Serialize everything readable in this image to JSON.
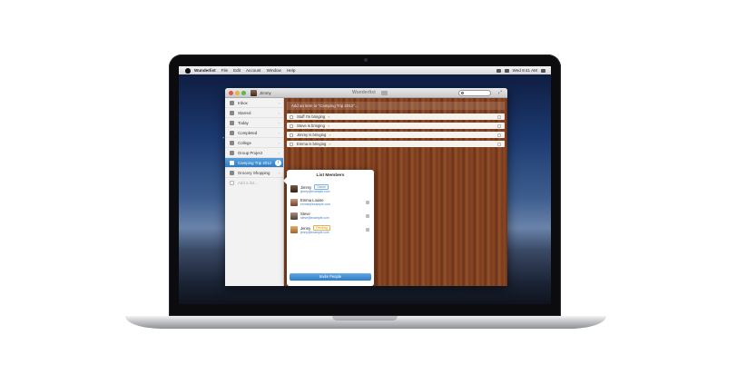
{
  "menubar": {
    "app_name": "Wunderlist",
    "menus": [
      "File",
      "Edit",
      "Account",
      "Window",
      "Help"
    ],
    "clock": "Wed 9:41 AM"
  },
  "window": {
    "title": "Wunderlist",
    "username": "Jimmy"
  },
  "sidebar": {
    "items": [
      {
        "label": "Inbox",
        "icon": "inbox-icon"
      },
      {
        "label": "Starred",
        "icon": "star-icon"
      },
      {
        "label": "Today",
        "icon": "calendar-icon"
      },
      {
        "label": "Completed",
        "icon": "check-icon"
      },
      {
        "label": "College",
        "icon": "list-icon"
      },
      {
        "label": "Group Project",
        "icon": "list-icon"
      },
      {
        "label": "Camping Trip 2012",
        "icon": "shared-list-icon",
        "active": true
      },
      {
        "label": "Grocery Shopping",
        "icon": "list-icon"
      },
      {
        "label": "Add a list...",
        "icon": "plus-icon"
      }
    ]
  },
  "content": {
    "add_placeholder": "Add an item to \"Camping Trip 2012\"...",
    "tasks": [
      "Stuff I'm bringing",
      "Steve is bringing",
      "Jimmy is bringing",
      "Emma is bringing"
    ]
  },
  "members_popover": {
    "title": "List Members",
    "members": [
      {
        "name": "Jimmy",
        "tag": "Owner",
        "email": "jimmy@example.com"
      },
      {
        "name": "Emma Louise",
        "tag": "",
        "email": "emma@example.com"
      },
      {
        "name": "Steve",
        "tag": "",
        "email": "steve@example.com"
      },
      {
        "name": "Jenny",
        "tag": "Pending",
        "email": "jenny@example.com"
      }
    ],
    "invite_label": "Invite People"
  },
  "colors": {
    "accent": "#2f7cc4",
    "wood": "#7a3b1d",
    "pending": "#e7b14a"
  }
}
